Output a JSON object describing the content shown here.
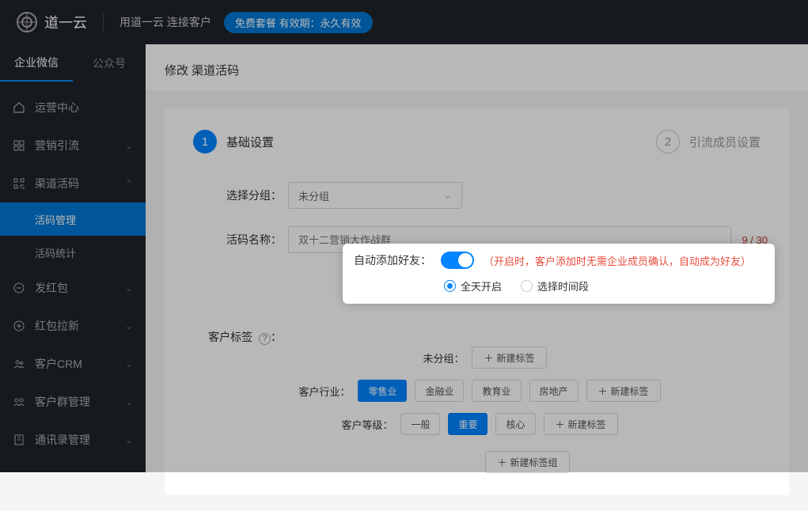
{
  "header": {
    "brand": "道一云",
    "slogan": "用道一云 连接客户",
    "badge": "免费套餐 有效期：永久有效"
  },
  "sidebar": {
    "tabs": [
      "企业微信",
      "公众号"
    ],
    "active_tab": 0,
    "items": [
      {
        "label": "运营中心",
        "expandable": false
      },
      {
        "label": "营销引流",
        "expandable": true
      },
      {
        "label": "渠道活码",
        "expandable": true,
        "expanded": true,
        "children": [
          "活码管理",
          "活码统计"
        ],
        "active_child": 0
      },
      {
        "label": "发红包",
        "expandable": true
      },
      {
        "label": "红包拉新",
        "expandable": true
      },
      {
        "label": "客户CRM",
        "expandable": true
      },
      {
        "label": "客户群管理",
        "expandable": true
      },
      {
        "label": "通讯录管理",
        "expandable": true
      }
    ]
  },
  "page": {
    "title": "修改 渠道活码"
  },
  "steps": [
    {
      "num": "1",
      "label": "基础设置",
      "active": true
    },
    {
      "num": "2",
      "label": "引流成员设置",
      "active": false
    }
  ],
  "form": {
    "group_label": "选择分组：",
    "group_value": "未分组",
    "name_label": "活码名称：",
    "name_placeholder": "双十二营销大作战群",
    "name_count": "9 / 30",
    "auto_add_label": "自动添加好友：",
    "auto_add_hint": "（开启时，客户添加时无需企业成员确认，自动成为好友）",
    "radio_all_day": "全天开启",
    "radio_time_range": "选择时间段",
    "tags_label": "客户标签",
    "help_q": "?",
    "tag_rows": [
      {
        "label": "未分组：",
        "tags": [],
        "new": "新建标签"
      },
      {
        "label": "客户行业：",
        "tags": [
          {
            "text": "零售业",
            "primary": true
          },
          {
            "text": "金融业"
          },
          {
            "text": "教育业"
          },
          {
            "text": "房地产"
          }
        ],
        "new": "新建标签"
      },
      {
        "label": "客户等级：",
        "tags": [
          {
            "text": "一般"
          },
          {
            "text": "重要",
            "primary": true
          },
          {
            "text": "核心"
          }
        ],
        "new": "新建标签"
      }
    ],
    "new_group": "新建标签组",
    "plus": "＋"
  }
}
